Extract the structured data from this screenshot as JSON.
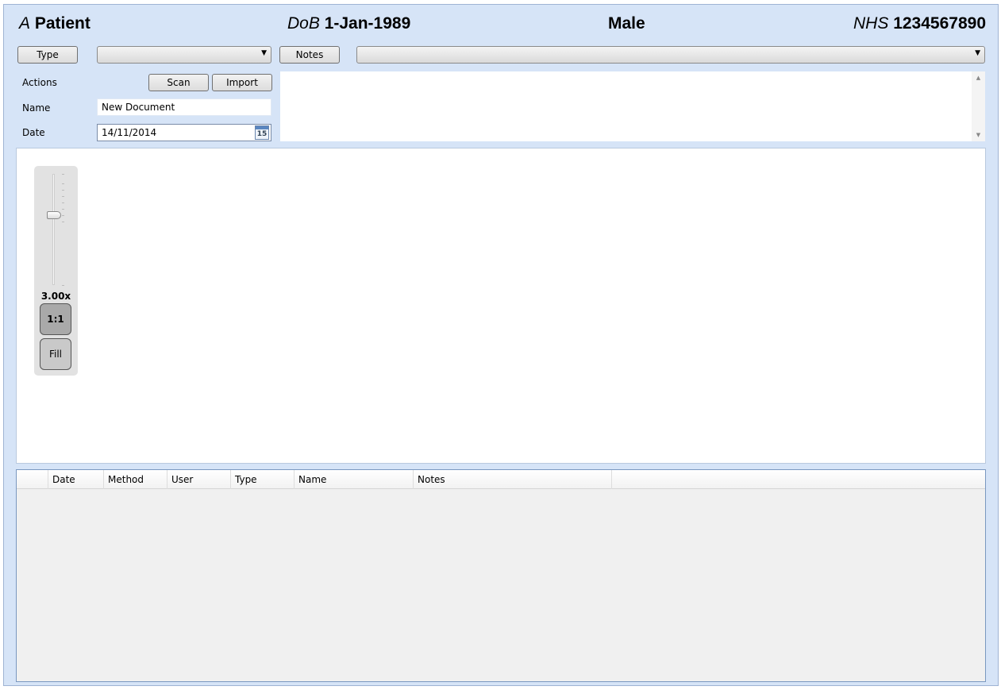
{
  "header": {
    "name_prefix": "A",
    "name": "Patient",
    "dob_label": "DoB",
    "dob": "1-Jan-1989",
    "sex": "Male",
    "nhs_label": "NHS",
    "nhs": "1234567890"
  },
  "toolbar": {
    "type_label": "Type",
    "type_value": "",
    "notes_label": "Notes",
    "notes_value": ""
  },
  "form": {
    "actions_label": "Actions",
    "scan_label": "Scan",
    "import_label": "Import",
    "name_label": "Name",
    "name_value": "New Document",
    "date_label": "Date",
    "date_value": "14/11/2014",
    "calendar_day": "15"
  },
  "notes_text": "",
  "viewer": {
    "zoom_level": "3.00x",
    "one_to_one_label": "1:1",
    "fill_label": "Fill",
    "icon_calendar": "calendar-icon"
  },
  "grid": {
    "columns": [
      "",
      "Date",
      "Method",
      "User",
      "Type",
      "Name",
      "Notes"
    ],
    "rows": []
  }
}
